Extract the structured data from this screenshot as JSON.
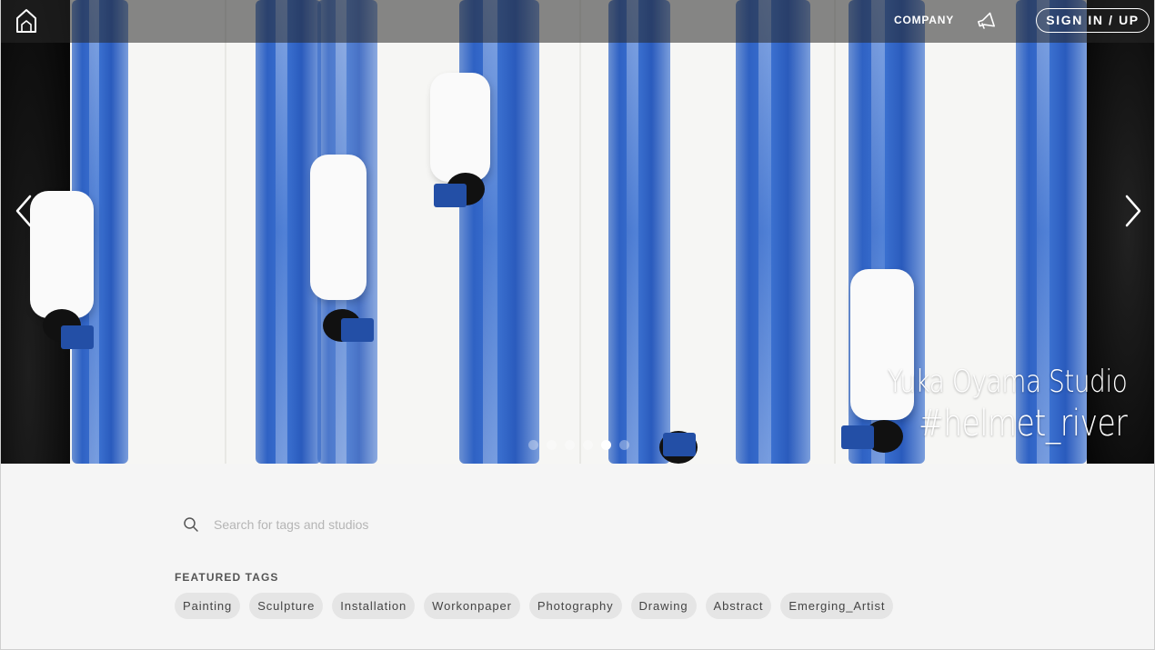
{
  "navbar": {
    "logo_icon": "house-logo-icon",
    "company_label": "COMPANY",
    "announcement_icon": "megaphone-icon",
    "signin_label": "SIGN IN / UP"
  },
  "hero": {
    "caption_line1": "Yuka Oyama Studio",
    "caption_line2": "#helmet_river",
    "prev_icon": "chevron-left-icon",
    "next_icon": "chevron-right-icon",
    "slide_count": 6,
    "active_slide": 5
  },
  "search": {
    "icon": "search-icon",
    "placeholder": "Search for tags and studios",
    "value": ""
  },
  "featured_tags": {
    "title": "FEATURED TAGS",
    "items": [
      "Painting",
      "Sculpture",
      "Installation",
      "Workonpaper",
      "Photography",
      "Drawing",
      "Abstract",
      "Emerging_Artist"
    ]
  }
}
